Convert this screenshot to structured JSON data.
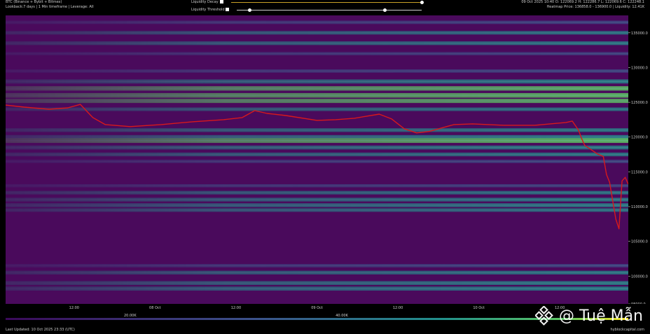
{
  "header": {
    "title": "BTC (Binance + Bybit + Bitmex)",
    "subtitle": "Lookback:7 days | 1 Min timeframe | Leverage: All",
    "decay_label": "Liquidity Decay",
    "threshold_label": "Liquidity Threshold",
    "ohlc": "09 Oct 2025 10:40 O: 122069.2 H: 122286.7 L: 122069.6 C: 122248.1",
    "heatmap_info": "Heatmap Price: 136858.0 - 136900.0 | Liquidity: 12.41K"
  },
  "controls": {
    "decay_value": 1.0,
    "threshold_value": 0.8
  },
  "footer": {
    "last_updated": "Last Updated: 10 Oct 2025 23:33 (UTC)",
    "site": "hyblockcapital.com"
  },
  "watermark": {
    "text": "@ Tuệ Mẫn",
    "icon": "diamond-logo-icon"
  },
  "colors": {
    "background": "#4a0a5c",
    "low": "#46085c",
    "mid": "#3b528b",
    "high": "#21918c",
    "peak": "#5ec962",
    "top": "#fde725",
    "price_line": "#d7191c"
  },
  "chart_data": {
    "type": "heatmap",
    "title": "",
    "xlabel": "",
    "ylabel": "",
    "ylim": [
      96000,
      137500
    ],
    "x_ticks": [
      "12:00",
      "08 Oct",
      "12:00",
      "09 Oct",
      "12:00",
      "10 Oct",
      "12:00"
    ],
    "y_ticks": [
      {
        "label": "135000.0",
        "value": 135000
      },
      {
        "label": "130000.0",
        "value": 130000
      },
      {
        "label": "125000.0",
        "value": 125000
      },
      {
        "label": "120000.0",
        "value": 120000
      },
      {
        "label": "115000.0",
        "value": 115000
      },
      {
        "label": "110000.0",
        "value": 110000
      },
      {
        "label": "105000.0",
        "value": 105000
      },
      {
        "label": "100000.0",
        "value": 100000
      },
      {
        "label": "98000.0",
        "value": 96000
      }
    ],
    "colorbar_ticks": [
      "20.00K",
      "40.00K"
    ],
    "liquidity_bands": [
      {
        "price": 136500,
        "intensity": 0.35
      },
      {
        "price": 135000,
        "intensity": 0.4
      },
      {
        "price": 133500,
        "intensity": 0.45
      },
      {
        "price": 132000,
        "intensity": 0.3
      },
      {
        "price": 129500,
        "intensity": 0.35
      },
      {
        "price": 128000,
        "intensity": 0.55
      },
      {
        "price": 127000,
        "intensity": 0.65
      },
      {
        "price": 126000,
        "intensity": 0.7
      },
      {
        "price": 125200,
        "intensity": 0.6
      },
      {
        "price": 124000,
        "intensity": 0.4
      },
      {
        "price": 121000,
        "intensity": 0.45
      },
      {
        "price": 120000,
        "intensity": 0.55
      },
      {
        "price": 119500,
        "intensity": 0.75
      },
      {
        "price": 118500,
        "intensity": 0.5
      },
      {
        "price": 117500,
        "intensity": 0.45
      },
      {
        "price": 116500,
        "intensity": 0.35
      },
      {
        "price": 113000,
        "intensity": 0.3
      },
      {
        "price": 112000,
        "intensity": 0.4
      },
      {
        "price": 111000,
        "intensity": 0.45
      },
      {
        "price": 110200,
        "intensity": 0.5
      },
      {
        "price": 109500,
        "intensity": 0.4
      },
      {
        "price": 101500,
        "intensity": 0.35
      },
      {
        "price": 100500,
        "intensity": 0.45
      },
      {
        "price": 99000,
        "intensity": 0.5
      },
      {
        "price": 98200,
        "intensity": 0.55
      }
    ],
    "price_series": {
      "name": "BTC",
      "x": [
        0,
        0.03,
        0.07,
        0.1,
        0.12,
        0.14,
        0.16,
        0.2,
        0.25,
        0.3,
        0.35,
        0.38,
        0.4,
        0.42,
        0.45,
        0.5,
        0.53,
        0.56,
        0.6,
        0.62,
        0.64,
        0.66,
        0.68,
        0.7,
        0.72,
        0.75,
        0.8,
        0.85,
        0.9,
        0.91,
        0.92,
        0.925,
        0.93,
        0.94,
        0.95,
        0.96,
        0.965,
        0.97,
        0.98,
        0.985,
        0.99,
        0.995,
        1.0
      ],
      "y": [
        124600,
        124300,
        124000,
        124200,
        124700,
        122800,
        121800,
        121500,
        121800,
        122200,
        122500,
        122800,
        123800,
        123400,
        123100,
        122400,
        122500,
        122700,
        123300,
        122600,
        121200,
        120600,
        120800,
        121300,
        121800,
        121900,
        121700,
        121700,
        122100,
        122300,
        121000,
        119800,
        118800,
        118200,
        117600,
        117200,
        114600,
        113500,
        108200,
        106800,
        113700,
        114200,
        113200
      ]
    }
  }
}
